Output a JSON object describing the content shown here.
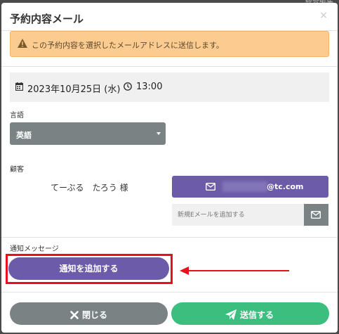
{
  "background": {
    "corner_text": "統合編集"
  },
  "modal": {
    "title": "予約内容メール",
    "close_glyph": "×"
  },
  "alert": {
    "message": "この予約内容を選択したメールアドレスに送信します。"
  },
  "booking": {
    "date": "2023年10月25日 (水)",
    "time": "13:00"
  },
  "language": {
    "label": "言語",
    "selected": "英語"
  },
  "customer": {
    "label": "顧客",
    "name": "てーぶる　たろう 様",
    "email_domain": "@tc.com",
    "add_email_placeholder": "新規Eメールを追加する"
  },
  "notification": {
    "label": "通知メッセージ",
    "add_button": "通知を追加する"
  },
  "footer": {
    "close_button": "閉じる",
    "send_button": "送信する"
  },
  "colors": {
    "primary": "#6c5ba8",
    "gray": "#7a8283",
    "success": "#3cbe7e",
    "warning_bg": "#fccb8f",
    "highlight": "#e8101a"
  }
}
